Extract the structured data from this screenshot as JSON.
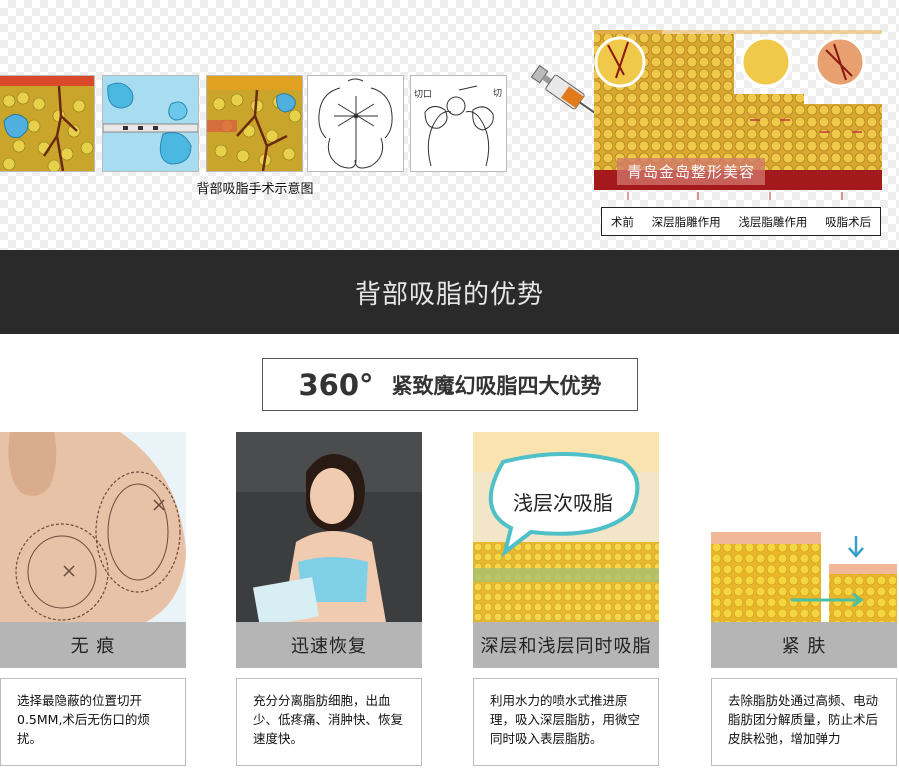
{
  "diagram": {
    "caption": "背部吸脂手术示意图",
    "sketch_label_left": "切口",
    "sketch_label_right": "切",
    "brand_badge": "青岛金岛整形美容",
    "legend": [
      "术前",
      "深层脂雕作用",
      "浅层脂雕作用",
      "吸脂术后"
    ]
  },
  "section": {
    "title": "背部吸脂的优势",
    "subtitle_degree": "360°",
    "subtitle_text": "紧致魔幻吸脂四大优势"
  },
  "cards": [
    {
      "title": "无 痕",
      "desc": "选择最隐蔽的位置切开0.5MM,术后无伤口的烦扰。"
    },
    {
      "title": "迅速恢复",
      "desc": "充分分离脂肪细胞，出血少、低疼痛、消肿快、恢复速度快。"
    },
    {
      "title": "深层和浅层同时吸脂",
      "desc": "利用水力的喷水式推进原理，吸入深层脂肪，用微空同时吸入表层脂肪。",
      "image_label": "浅层次吸脂"
    },
    {
      "title": "紧 肤",
      "desc": "去除脂肪处通过高频、电动脂肪团分解质量，防止术后皮肤松弛，增加弹力"
    }
  ],
  "colors": {
    "band": "#2a2a2a",
    "card_bar": "#b5b5b5",
    "fat": "#e8c23a"
  }
}
